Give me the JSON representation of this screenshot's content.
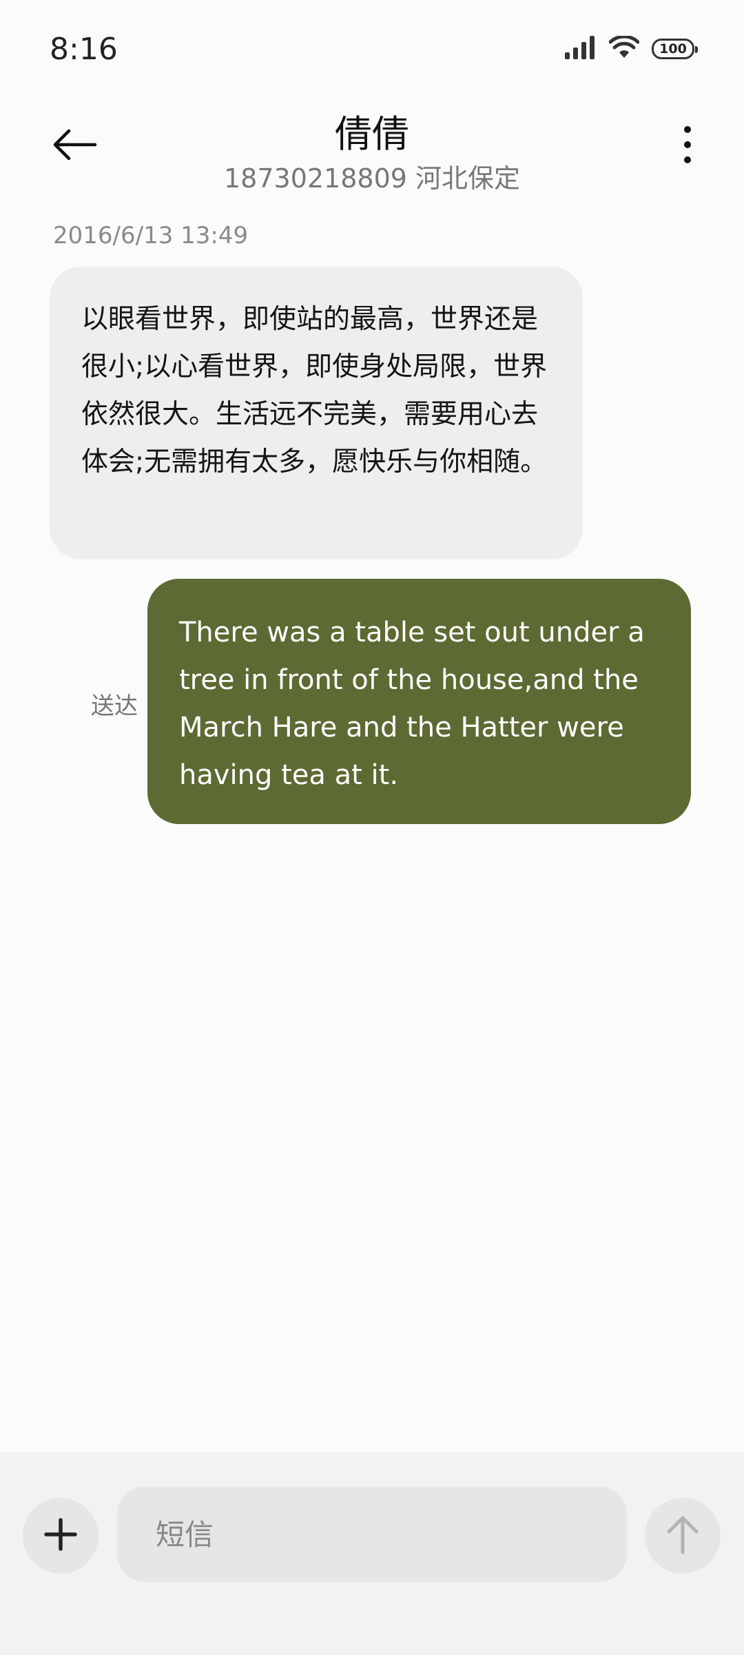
{
  "status_bar": {
    "time": "8:16",
    "battery": "100",
    "icons": [
      "signal-icon",
      "wifi-icon",
      "battery-icon"
    ]
  },
  "header": {
    "contact_name": "倩倩",
    "contact_info": "18730218809 河北保定",
    "icons": [
      "back-arrow-icon",
      "more-vertical-icon"
    ]
  },
  "conversation": {
    "timestamp": "2016/6/13 13:49",
    "messages": [
      {
        "direction": "incoming",
        "text": "以眼看世界，即使站的最高，世界还是很小;以心看世界，即使身处局限，世界依然很大。生活远不完美，需要用心去体会;无需拥有太多，愿快乐与你相随。"
      },
      {
        "direction": "outgoing",
        "status": "送达",
        "text": "There was a table set out under a tree in front of the house,and the March Hare and the Hatter were having tea at it."
      }
    ]
  },
  "composer": {
    "placeholder": "短信",
    "value": "",
    "icons": [
      "plus-icon",
      "send-arrow-up-icon"
    ]
  },
  "colors": {
    "outgoing_bubble": "#5c6a33",
    "incoming_bubble": "#eeeeee",
    "background": "#fbfbfb"
  }
}
